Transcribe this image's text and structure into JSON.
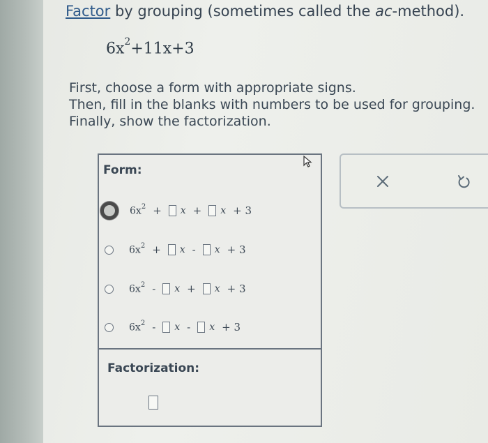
{
  "heading": {
    "link_word": "Factor",
    "text_before_italic": " by grouping (sometimes called the ",
    "italic": "ac",
    "text_after_italic": "-method)."
  },
  "expression": {
    "coef_a": "6x",
    "exp_a": "2",
    "middle": "+11x",
    "end": "+3"
  },
  "instructions": [
    "First, choose a form with appropriate signs.",
    "Then, fill in the blanks with numbers to be used for grouping.",
    "Finally, show the factorization."
  ],
  "form": {
    "label": "Form:",
    "options": [
      {
        "coef": "6x",
        "exp": "2",
        "op1": "+",
        "var1": "x",
        "op2": "+",
        "var2": "x",
        "tail": "+ 3",
        "selected": true
      },
      {
        "coef": "6x",
        "exp": "2",
        "op1": "+",
        "var1": "x",
        "op2": "-",
        "var2": "x",
        "tail": "+ 3",
        "selected": false
      },
      {
        "coef": "6x",
        "exp": "2",
        "op1": "-",
        "var1": "x",
        "op2": "+",
        "var2": "x",
        "tail": "+ 3",
        "selected": false
      },
      {
        "coef": "6x",
        "exp": "2",
        "op1": "-",
        "var1": "x",
        "op2": "-",
        "var2": "x",
        "tail": "+ 3",
        "selected": false
      }
    ]
  },
  "factorization": {
    "label": "Factorization:"
  },
  "actions": {
    "clear_icon": "x-icon",
    "undo_icon": "undo-icon"
  },
  "colors": {
    "text": "#2d3a46",
    "border": "#6a7480",
    "link": "#2f5a8a"
  }
}
